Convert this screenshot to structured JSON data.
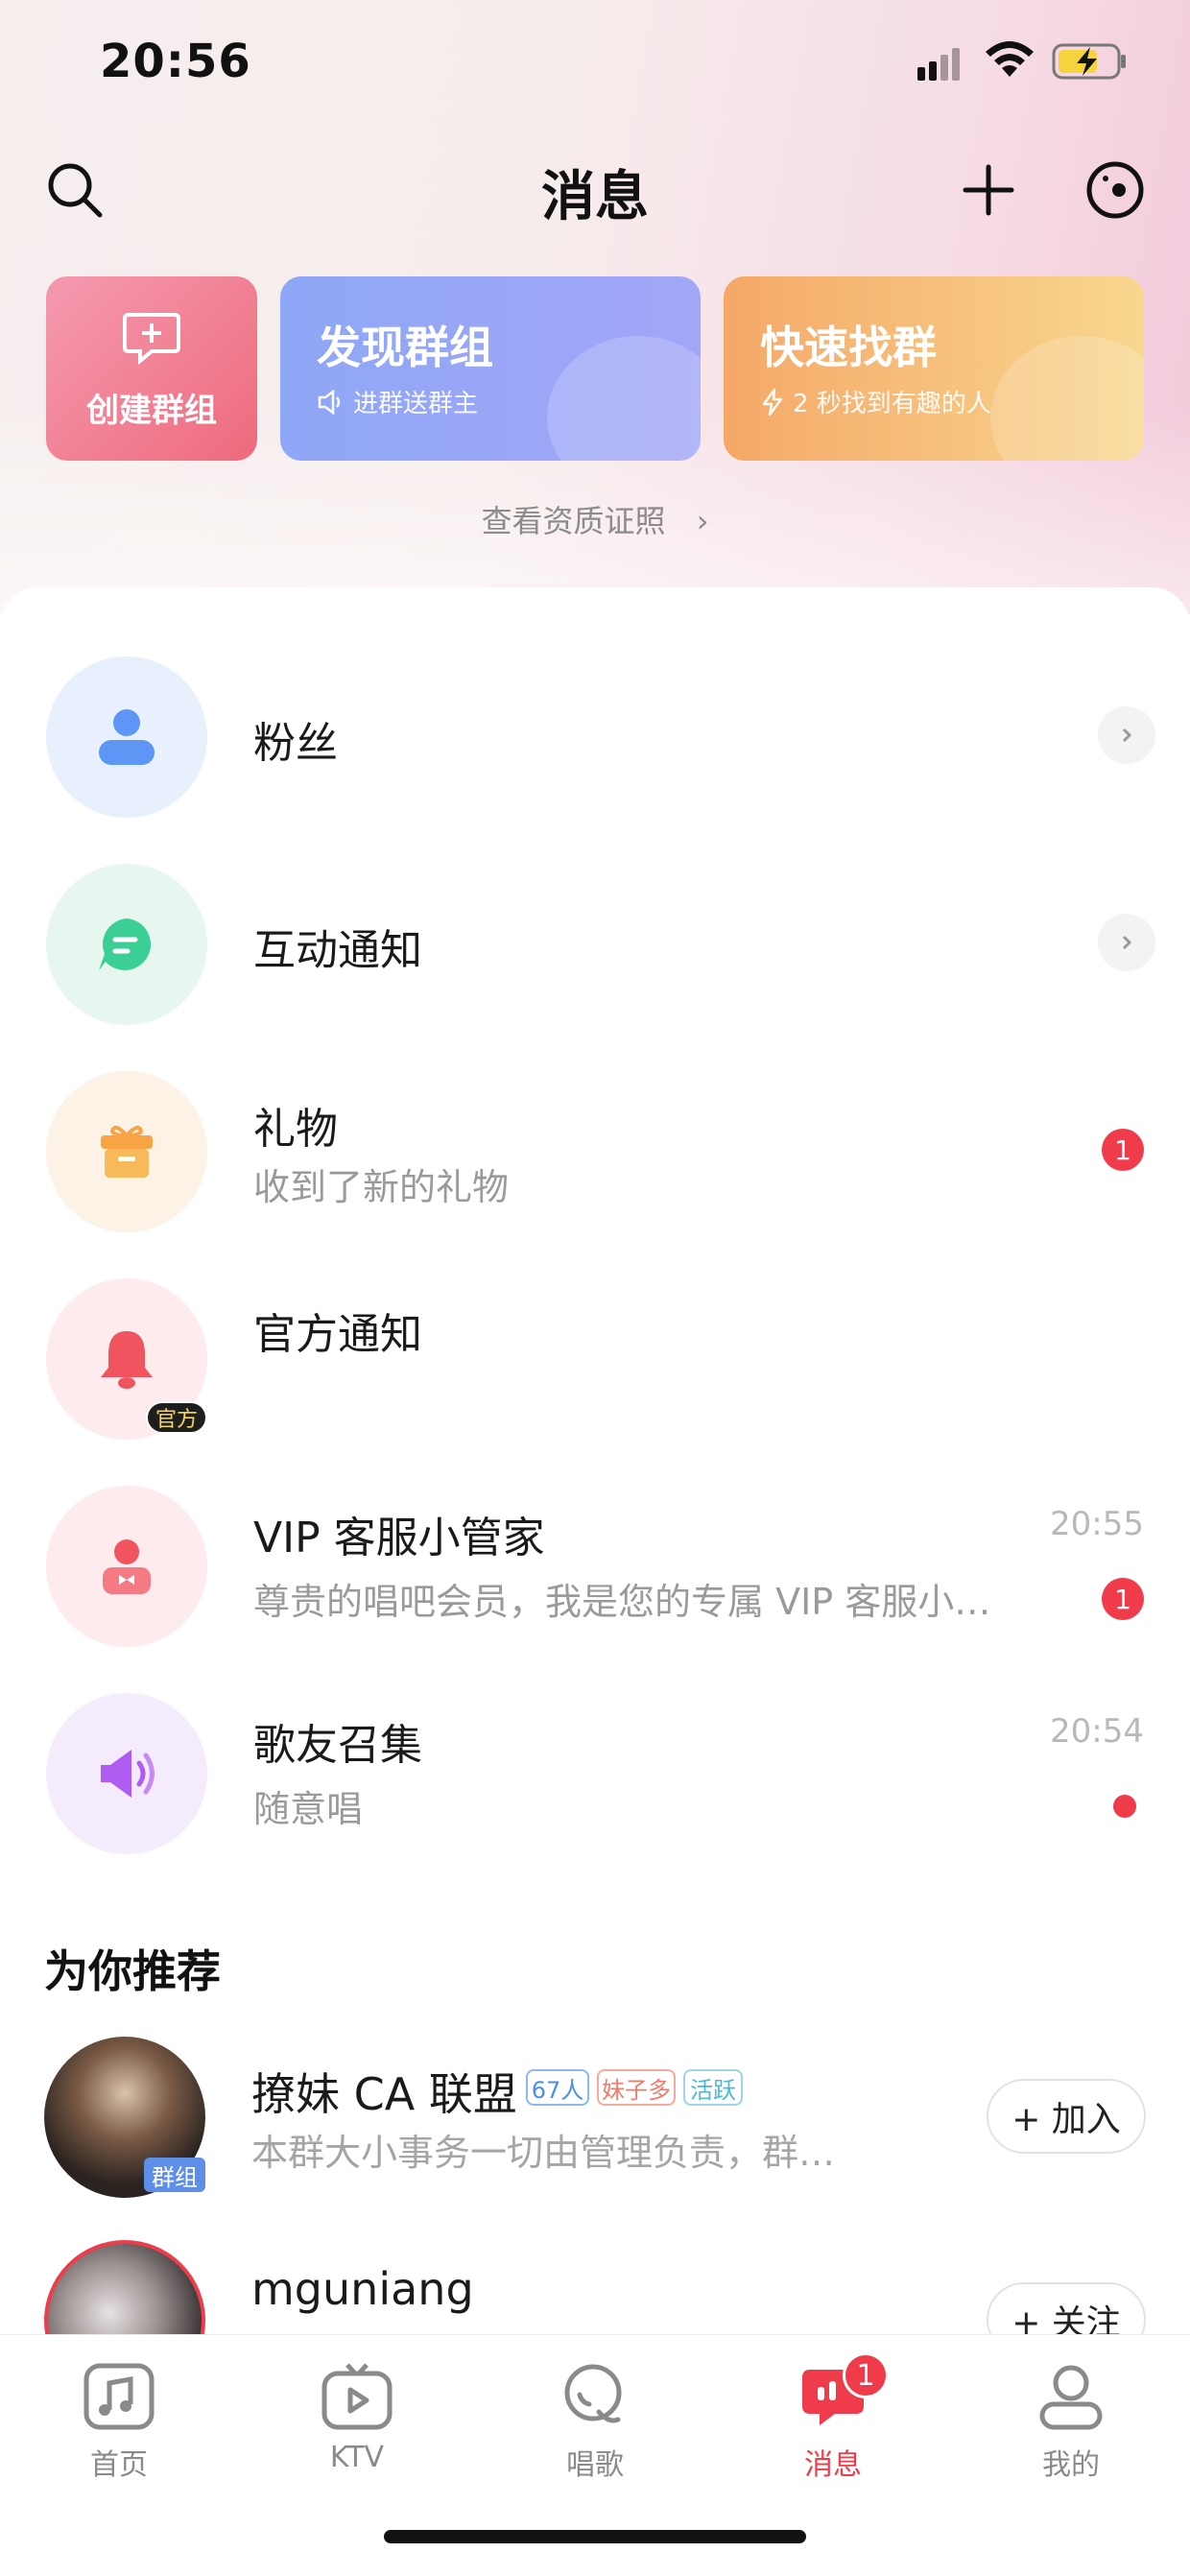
{
  "status_bar": {
    "time": "20:56"
  },
  "header": {
    "title": "消息"
  },
  "cards": {
    "create": {
      "label": "创建群组"
    },
    "discover": {
      "title": "发现群组",
      "subtitle": "进群送群主"
    },
    "quick": {
      "title": "快速找群",
      "subtitle": "2 秒找到有趣的人"
    }
  },
  "qualification_link": "查看资质证照",
  "messages": [
    {
      "title": "粉丝",
      "subtitle": "",
      "time": "",
      "icon": "person-icon",
      "color": "#5d96f5"
    },
    {
      "title": "互动通知",
      "subtitle": "",
      "time": "",
      "icon": "chat-bubble-icon",
      "color": "#3ccf95"
    },
    {
      "title": "礼物",
      "subtitle": "收到了新的礼物",
      "time": "",
      "badge": "1",
      "icon": "gift-icon",
      "color": "#f6a444"
    },
    {
      "title": "官方通知",
      "subtitle": "",
      "time": "",
      "icon": "bell-icon",
      "tag": "官方",
      "color": "#f0545e"
    },
    {
      "title": "VIP 客服小管家",
      "subtitle": "尊贵的唱吧会员，我是您的专属 VIP 客服小…",
      "time": "20:55",
      "badge": "1",
      "icon": "service-person-icon",
      "color": "#f0545e"
    },
    {
      "title": "歌友召集",
      "subtitle": "随意唱",
      "time": "20:54",
      "dot": true,
      "icon": "megaphone-icon",
      "color": "#b05cf0"
    }
  ],
  "recommend": {
    "section_title": "为你推荐",
    "items": [
      {
        "name": "撩妹 CA 联盟",
        "subtitle": "本群大小事务一切由管理负责，群…",
        "tags": [
          "67人",
          "妹子多",
          "活跃"
        ],
        "avatar_tag": "群组",
        "button": "+ 加入"
      },
      {
        "name": "mguniang",
        "subtitle": "",
        "button": "+ 关注"
      }
    ]
  },
  "tabbar": {
    "tabs": [
      {
        "label": "首页",
        "icon": "music-note-icon"
      },
      {
        "label": "KTV",
        "icon": "tv-play-icon"
      },
      {
        "label": "唱歌",
        "icon": "microphone-icon"
      },
      {
        "label": "消息",
        "icon": "message-icon",
        "badge": "1",
        "active": true
      },
      {
        "label": "我的",
        "icon": "profile-icon"
      }
    ]
  },
  "colors": {
    "accent": "#f03c4a",
    "active_tab": "#f03c4a"
  }
}
